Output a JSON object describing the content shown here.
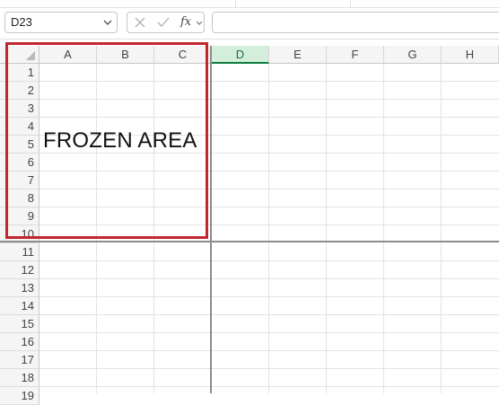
{
  "formula_bar": {
    "name_box_value": "D23",
    "name_box_dropdown_icon": "chevron-down-icon",
    "cancel_icon": "close-icon",
    "confirm_icon": "check-icon",
    "function_label": "fx",
    "function_dropdown_icon": "chevron-down-icon",
    "formula_value": ""
  },
  "sheet": {
    "columns": [
      "A",
      "B",
      "C",
      "D",
      "E",
      "F",
      "G",
      "H"
    ],
    "active_column": "D",
    "rows": [
      "1",
      "2",
      "3",
      "4",
      "5",
      "6",
      "7",
      "8",
      "9",
      "10",
      "11",
      "12",
      "13",
      "14",
      "15",
      "16",
      "17",
      "18",
      "19"
    ]
  },
  "annotation": {
    "frozen_label": "FROZEN AREA",
    "highlight_color": "#c2272d"
  },
  "colors": {
    "active_header_bg": "#d3eedb",
    "active_header_accent": "#107c41",
    "header_bg": "#f5f5f5",
    "gridline": "#e3e3e3",
    "freeze_line": "#8c8c8c"
  }
}
